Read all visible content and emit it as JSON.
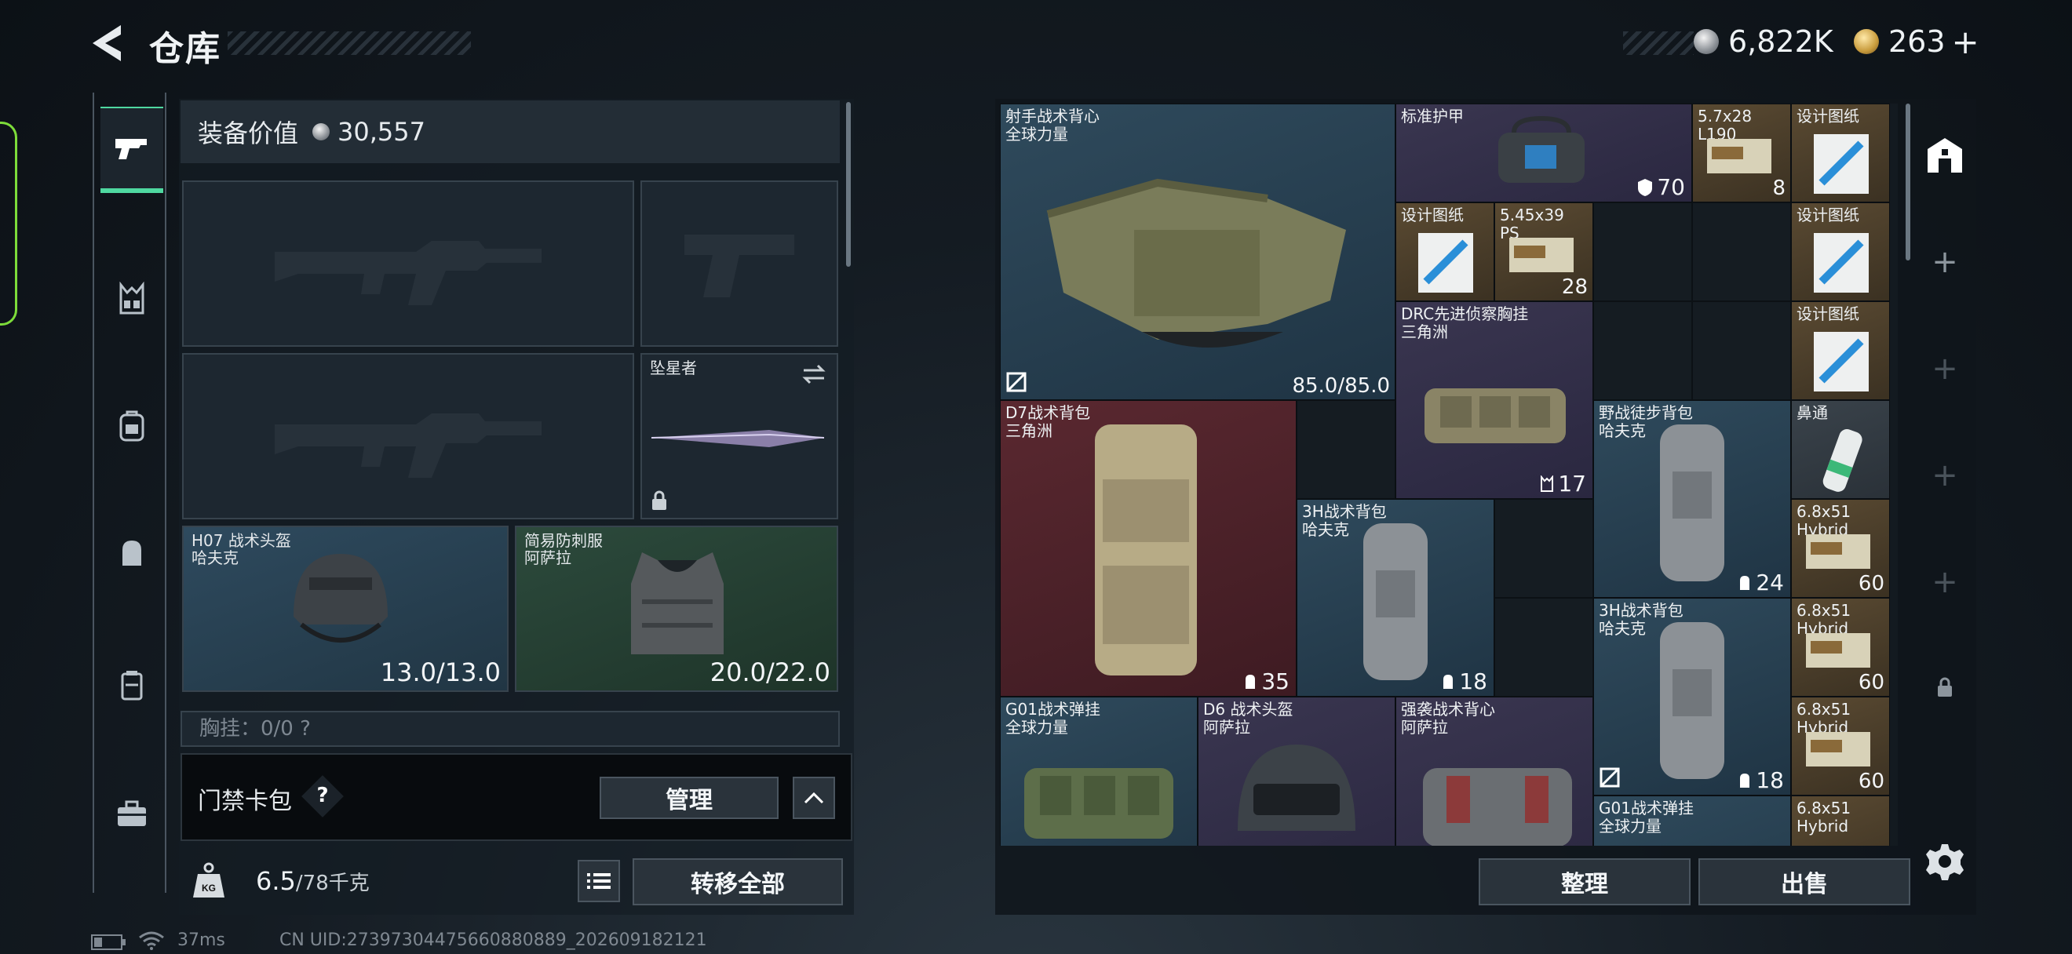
{
  "header": {
    "title": "仓库",
    "currencies": [
      {
        "icon": "silver-coin-icon",
        "value": "6,822K"
      },
      {
        "icon": "gold-coin-icon",
        "value": "263"
      }
    ],
    "add_label": "+"
  },
  "equipment": {
    "value_label": "装备价值",
    "value": "30,557",
    "melee_name": "坠星者",
    "helmet": {
      "name": "H07 战术头盔",
      "faction": "哈夫克",
      "durability": "13.0/13.0"
    },
    "armor": {
      "name": "简易防刺服",
      "faction": "阿萨拉",
      "durability": "20.0/22.0"
    },
    "chest_label": "胸挂：0/0 ?"
  },
  "card_pack": {
    "label": "门禁卡包",
    "help": "?",
    "manage_label": "管理"
  },
  "weight": {
    "value": "6.5",
    "unit": "/78千克"
  },
  "transfer_all_label": "转移全部",
  "inventory": {
    "items": [
      {
        "name": "射手战术背心",
        "sub": "全球力量",
        "val": "85.0/85.0"
      },
      {
        "name": "标准护甲",
        "sub": "",
        "val": "70"
      },
      {
        "name": "5.7x28",
        "sub": "L190",
        "val": "8"
      },
      {
        "name": "设计图纸",
        "sub": "",
        "val": ""
      },
      {
        "name": "设计图纸",
        "sub": "",
        "val": ""
      },
      {
        "name": "5.45x39",
        "sub": "PS",
        "val": "28"
      },
      {
        "name": "设计图纸",
        "sub": "",
        "val": ""
      },
      {
        "name": "DRC先进侦察胸挂",
        "sub": "三角洲",
        "val": "17"
      },
      {
        "name": "设计图纸",
        "sub": "",
        "val": ""
      },
      {
        "name": "D7战术背包",
        "sub": "三角洲",
        "val": "35"
      },
      {
        "name": "野战徒步背包",
        "sub": "哈夫克",
        "val": "24"
      },
      {
        "name": "鼻通",
        "sub": "",
        "val": ""
      },
      {
        "name": "3H战术背包",
        "sub": "哈夫克",
        "val": "18"
      },
      {
        "name": "6.8x51",
        "sub": "Hybrid",
        "val": "60"
      },
      {
        "name": "3H战术背包",
        "sub": "哈夫克",
        "val": "18"
      },
      {
        "name": "6.8x51",
        "sub": "Hybrid",
        "val": "60"
      },
      {
        "name": "G01战术弹挂",
        "sub": "全球力量",
        "val": ""
      },
      {
        "name": "D6 战术头盔",
        "sub": "阿萨拉",
        "val": ""
      },
      {
        "name": "强袭战术背心",
        "sub": "阿萨拉",
        "val": ""
      },
      {
        "name": "6.8x51",
        "sub": "Hybrid",
        "val": "60"
      },
      {
        "name": "G01战术弹挂",
        "sub": "全球力量",
        "val": ""
      },
      {
        "name": "6.8x51",
        "sub": "Hybrid",
        "val": ""
      }
    ]
  },
  "actions": {
    "sort_label": "整理",
    "sell_label": "出售"
  },
  "status_bar": {
    "ping": "37ms",
    "uid": "CN UID:2739730447566088088​9_202609182121"
  }
}
